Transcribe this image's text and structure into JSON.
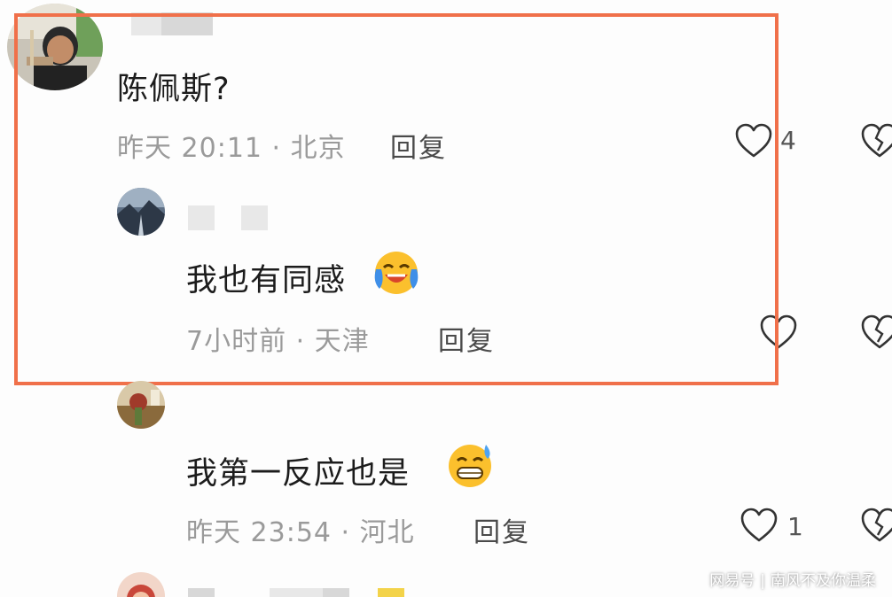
{
  "comments": [
    {
      "text": "陈佩斯?",
      "time": "昨天 20:11",
      "location": "北京",
      "reply_label": "回复",
      "like_count": "4"
    },
    {
      "text": "我也有同感",
      "time": "7小时前",
      "location": "天津",
      "reply_label": "回复",
      "like_count": ""
    },
    {
      "text": "我第一反应也是",
      "time": "昨天 23:54",
      "location": "河北",
      "reply_label": "回复",
      "like_count": "1"
    }
  ],
  "meta_separator": " · ",
  "watermark": {
    "brand": "网易号",
    "separator": "|",
    "author": "南风不及你温柔"
  },
  "colors": {
    "highlight_border": "#f0704a",
    "meta_text": "#9a9a9a",
    "body_text": "#1c1c1c"
  },
  "icons": {
    "like": "heart-outline-icon",
    "dislike": "broken-heart-icon",
    "emoji_crying_laughing": "crying-laughing-emoji",
    "emoji_grinning_sweat": "grinning-sweat-emoji"
  }
}
